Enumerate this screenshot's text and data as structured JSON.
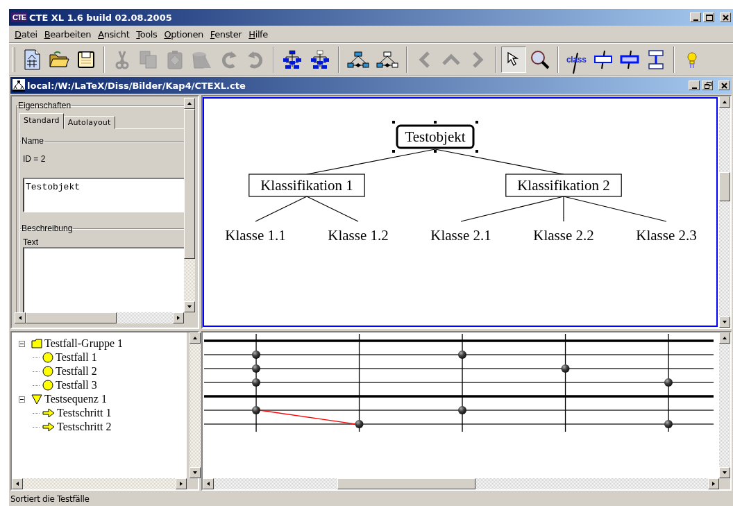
{
  "window": {
    "title": "CTE XL 1.6 build 02.08.2005",
    "logo": "CTE"
  },
  "menu": [
    {
      "label": "Datei"
    },
    {
      "label": "Bearbeiten"
    },
    {
      "label": "Ansicht"
    },
    {
      "label": "Tools"
    },
    {
      "label": "Optionen"
    },
    {
      "label": "Fenster"
    },
    {
      "label": "Hilfe"
    }
  ],
  "toolbar": {
    "items": [
      {
        "kind": "new",
        "disabled": false,
        "pressed": false
      },
      {
        "kind": "open",
        "disabled": false,
        "pressed": false
      },
      {
        "kind": "save",
        "disabled": false,
        "pressed": false
      },
      {
        "kind": "sep"
      },
      {
        "kind": "cut",
        "disabled": true,
        "pressed": false
      },
      {
        "kind": "copy",
        "disabled": true,
        "pressed": false
      },
      {
        "kind": "paste",
        "disabled": true,
        "pressed": false
      },
      {
        "kind": "delete",
        "disabled": true,
        "pressed": false
      },
      {
        "kind": "undo",
        "disabled": true,
        "pressed": false
      },
      {
        "kind": "redo",
        "disabled": true,
        "pressed": false
      },
      {
        "kind": "sep"
      },
      {
        "kind": "tree",
        "disabled": false,
        "pressed": false
      },
      {
        "kind": "tree_alt",
        "disabled": false,
        "pressed": false
      },
      {
        "kind": "sep"
      },
      {
        "kind": "layout",
        "disabled": false,
        "pressed": false
      },
      {
        "kind": "layout_alt",
        "disabled": false,
        "pressed": false
      },
      {
        "kind": "sep"
      },
      {
        "kind": "left",
        "disabled": true,
        "pressed": false
      },
      {
        "kind": "up",
        "disabled": true,
        "pressed": false
      },
      {
        "kind": "right",
        "disabled": true,
        "pressed": false
      },
      {
        "kind": "sep"
      },
      {
        "kind": "pointer",
        "disabled": false,
        "pressed": true
      },
      {
        "kind": "zoom",
        "disabled": false,
        "pressed": false
      },
      {
        "kind": "sep"
      },
      {
        "kind": "class",
        "label": "class",
        "disabled": false,
        "pressed": false
      },
      {
        "kind": "classification",
        "disabled": false,
        "pressed": false
      },
      {
        "kind": "classification_filled",
        "disabled": false,
        "pressed": false
      },
      {
        "kind": "composition",
        "disabled": false,
        "pressed": false
      },
      {
        "kind": "sep"
      },
      {
        "kind": "hint",
        "disabled": false,
        "pressed": false
      }
    ]
  },
  "document": {
    "title": "local:/W:/LaTeX/Diss/Bilder/Kap4/CTEXL.cte"
  },
  "properties": {
    "group": "Eigenschaften",
    "tabs": [
      {
        "label": "Standard",
        "selected": true
      },
      {
        "label": "Autolayout",
        "selected": false
      }
    ],
    "name_group": "Name",
    "id_text": "ID = 2",
    "name_value": "Testobjekt",
    "description_group": "Beschreibung",
    "text_label": "Text"
  },
  "diagram": {
    "root": {
      "label": "Testobjekt",
      "kind": "object",
      "selected": true,
      "children": [
        {
          "label": "Klassifikation 1",
          "kind": "classification",
          "selected": false,
          "children": [
            {
              "label": "Klasse 1.1",
              "kind": "class",
              "selected": false
            },
            {
              "label": "Klasse 1.2",
              "kind": "class",
              "selected": false
            }
          ]
        },
        {
          "label": "Klassifikation 2",
          "kind": "classification",
          "selected": false,
          "children": [
            {
              "label": "Klasse 2.1",
              "kind": "class",
              "selected": false
            },
            {
              "label": "Klasse 2.2",
              "kind": "class",
              "selected": false
            },
            {
              "label": "Klasse 2.3",
              "kind": "class",
              "selected": false
            }
          ]
        }
      ]
    }
  },
  "testcase_tree": [
    {
      "label": "Testfall-Gruppe 1",
      "kind": "group",
      "expanded": true,
      "children": [
        {
          "label": "Testfall 1",
          "kind": "case"
        },
        {
          "label": "Testfall 2",
          "kind": "case"
        },
        {
          "label": "Testfall 3",
          "kind": "case"
        }
      ]
    },
    {
      "label": "Testsequenz 1",
      "kind": "sequence",
      "expanded": true,
      "children": [
        {
          "label": "Testschritt 1",
          "kind": "step"
        },
        {
          "label": "Testschritt 2",
          "kind": "step"
        }
      ]
    }
  ],
  "matrix": {
    "rows": [
      {
        "kind": "group"
      },
      {
        "kind": "case",
        "marks": [
          true,
          false,
          true,
          false,
          false
        ]
      },
      {
        "kind": "case",
        "marks": [
          true,
          false,
          false,
          true,
          false
        ]
      },
      {
        "kind": "case",
        "marks": [
          true,
          false,
          false,
          false,
          true
        ]
      },
      {
        "kind": "group"
      },
      {
        "kind": "case",
        "marks": [
          true,
          false,
          true,
          false,
          false
        ],
        "linked_to_previous": false
      },
      {
        "kind": "case",
        "marks": [
          false,
          true,
          false,
          false,
          true
        ],
        "linked_to_previous": true
      }
    ]
  },
  "status_bar": {
    "text": "Sortiert die Testfälle"
  }
}
